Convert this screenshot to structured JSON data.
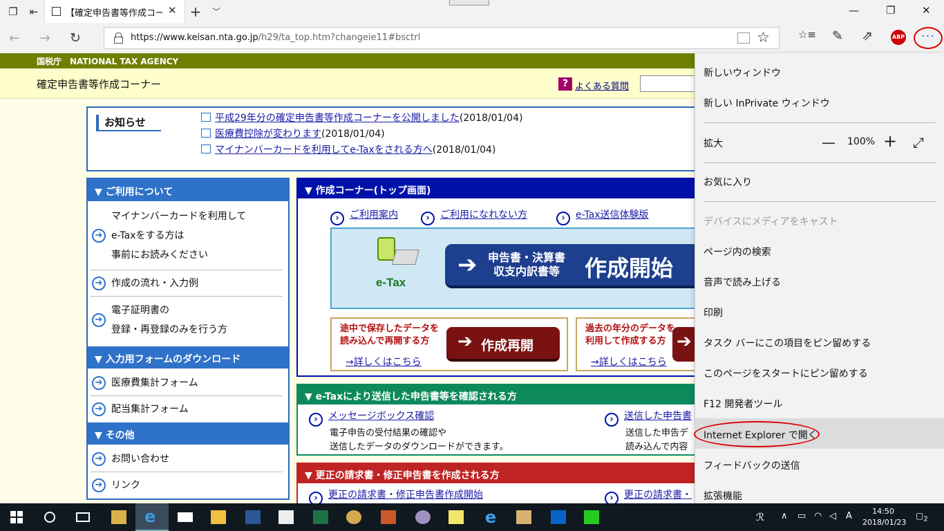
{
  "tab": {
    "title": "【確定申告書等作成コーナ",
    "close": "✕"
  },
  "tabbar": {
    "new_tab": "+",
    "tab_list": "﹀"
  },
  "window": {
    "minimize": "—",
    "maximize": "❐",
    "close": "✕"
  },
  "nav": {
    "back": "←",
    "forward": "→",
    "refresh": "↻"
  },
  "address": {
    "url_host": "https://www.keisan.nta.go.jp",
    "url_path": "/h29/ta_top.htm?changeie11#bsctrl",
    "favorite_glyph": "☆"
  },
  "toolbar": {
    "favorites_glyph": "☆≡",
    "notes_glyph": "✎",
    "share_glyph": "⇗",
    "adblock_label": "ABP",
    "more_glyph": "···"
  },
  "page": {
    "agency": "国税庁　NATIONAL TAX AGENCY",
    "site_title": "確定申告書等作成コーナー",
    "faq_icon": "?",
    "faq_link": "よくある質問",
    "notice": {
      "label": "お知らせ",
      "items": [
        {
          "link": "平成29年分の確定申告書等作成コーナーを公開しました",
          "date": "(2018/01/04)"
        },
        {
          "link": "医療費控除が変わります",
          "date": "(2018/01/04)"
        },
        {
          "link": "マイナンバーカードを利用してe-Taxをされる方へ",
          "date": "(2018/01/04)"
        }
      ]
    },
    "leftnav": {
      "sec1": "▼ ご利用について",
      "item1_l1": "マイナンバーカードを利用して",
      "item1_l2": "e-Taxをする方は",
      "item1_l3": "事前にお読みください",
      "item2": "作成の流れ・入力例",
      "item3_l1": "電子証明書の",
      "item3_l2": "登録・再登録のみを行う方",
      "sec2": "▼ 入力用フォームのダウンロード",
      "item4": "医療費集計フォーム",
      "item5": "配当集計フォーム",
      "sec3": "▼ その他",
      "item6": "お問い合わせ",
      "item7": "リンク",
      "arrow": "➔"
    },
    "main1": {
      "header": "▼ 作成コーナー(トップ画面)",
      "link1": "ご利用案内",
      "link2": "ご利用になれない方",
      "link3": "e-Tax送信体験版",
      "etax_logo": "e-Tax",
      "start_arrow": "➔",
      "start_sub_l1": "申告書・決算書",
      "start_sub_l2": "収支内訳書等",
      "start_big": "作成開始",
      "resume_desc_l1": "途中で保存したデータを",
      "resume_desc_l2": "読み込んで再開する方",
      "resume_more": "→詳しくはこちら",
      "resume_btn": "作成再開",
      "past_desc_l1": "過去の年分のデータを",
      "past_desc_l2": "利用して作成する方",
      "past_more": "→詳しくはこちら"
    },
    "main2": {
      "header": "▼ e-Taxにより送信した申告書等を確認される方",
      "left_link": "メッセージボックス確認",
      "left_p1": "電子申告の受付結果の確認や",
      "left_p2": "送信したデータのダウンロードができます。",
      "right_link": "送信した申告書",
      "right_p1": "送信した申告デ",
      "right_p2": "読み込んで内容"
    },
    "main3": {
      "header": "▼ 更正の請求書・修正申告書を作成される方",
      "left_link": "更正の請求書・修正申告書作成開始",
      "right_link": "更正の請求書・"
    }
  },
  "menu": {
    "new_window": "新しいウィンドウ",
    "new_inprivate": "新しい InPrivate ウィンドウ",
    "zoom_label": "拡大",
    "zoom_minus": "—",
    "zoom_value": "100%",
    "zoom_plus": "+",
    "zoom_fullscreen": "⤢",
    "favorites": "お気に入り",
    "cast": "デバイスにメディアをキャスト",
    "find": "ページ内の検索",
    "read_aloud": "音声で読み上げる",
    "print": "印刷",
    "pin_taskbar": "タスク バーにこの項目をピン留めする",
    "pin_start": "このページをスタートにピン留めする",
    "devtools": "F12 開発者ツール",
    "open_ie": "Internet Explorer で開く",
    "feedback": "フィードバックの送信",
    "extensions": "拡張機能"
  },
  "taskbar": {
    "clock_time": "14:50",
    "clock_date": "2018/01/23",
    "notifications": "2",
    "ime": "A",
    "tray_up": "∧",
    "person": "ℛ"
  }
}
